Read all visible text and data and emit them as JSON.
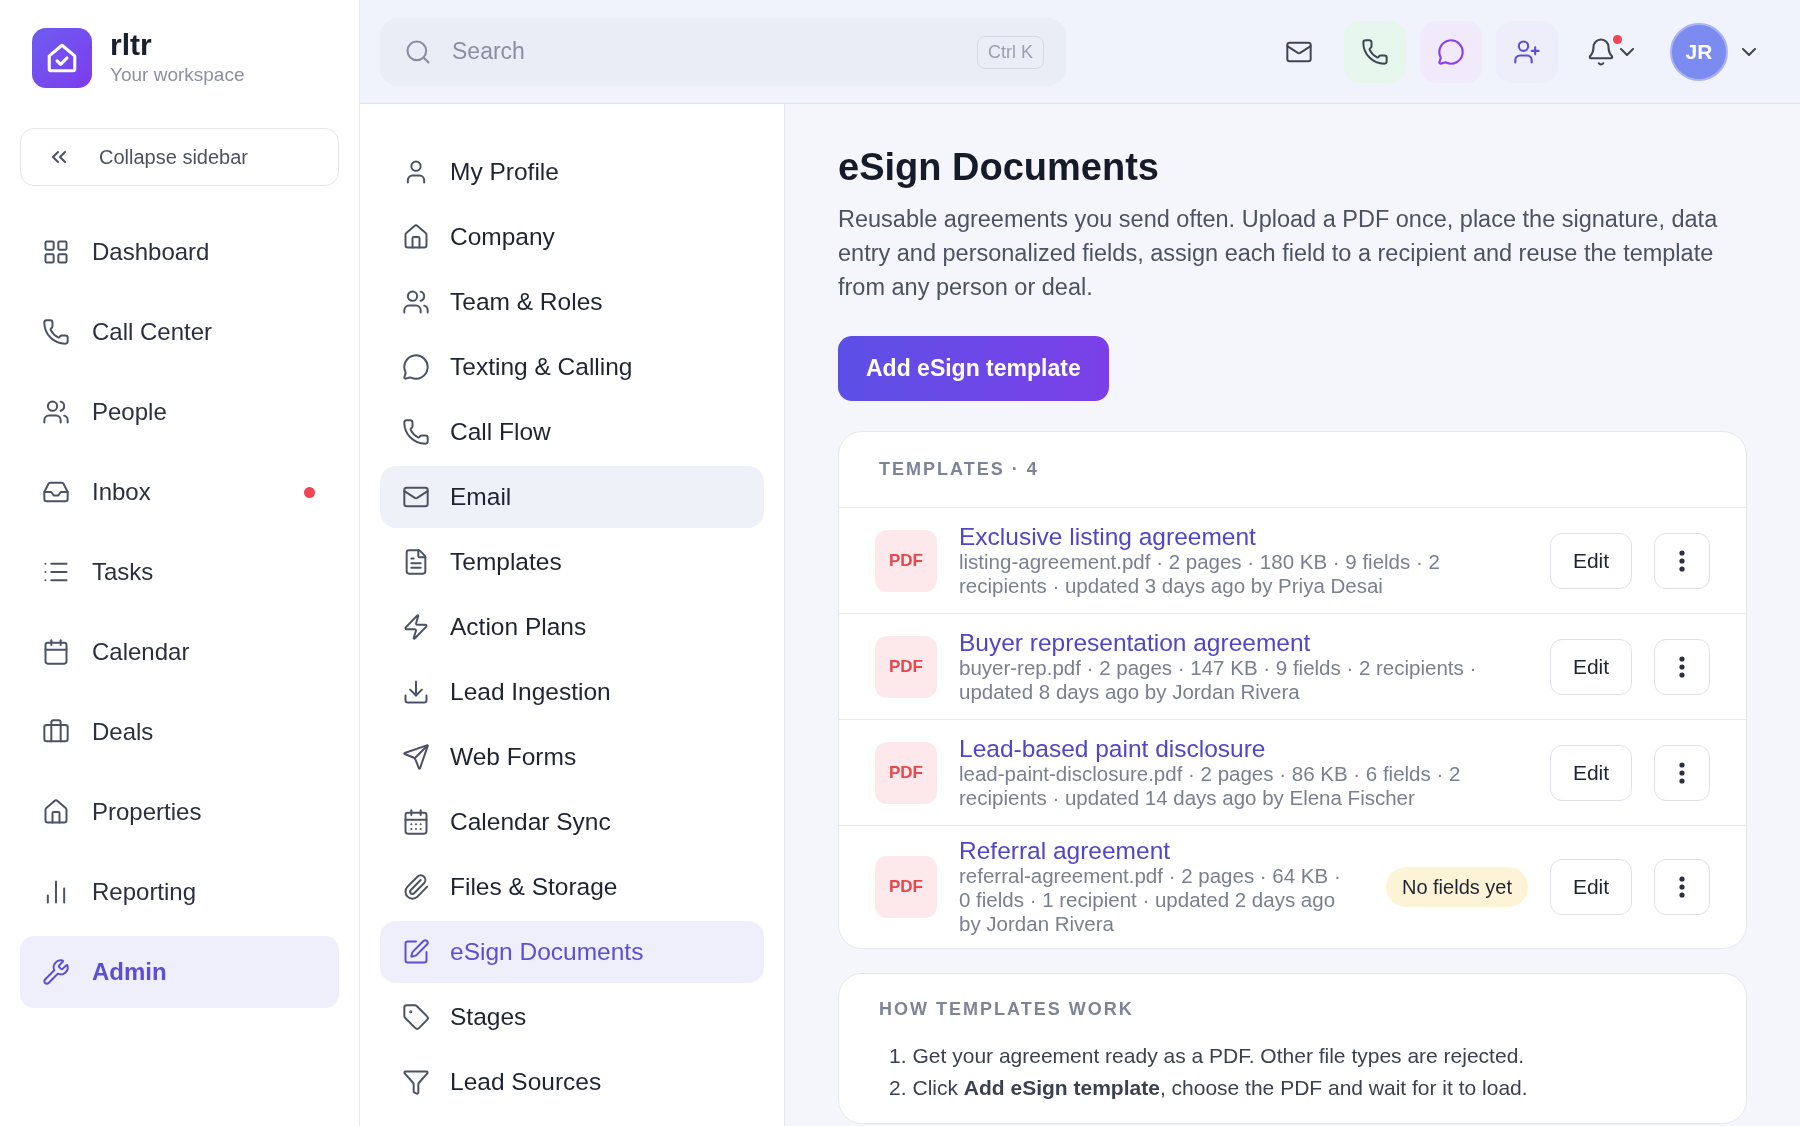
{
  "brand": {
    "name": "rltr",
    "subtitle": "Your workspace"
  },
  "collapse": {
    "label": "Collapse sidebar"
  },
  "sidebar": {
    "items": [
      {
        "label": "Dashboard",
        "selected": false,
        "dot": false
      },
      {
        "label": "Call Center",
        "selected": false,
        "dot": false
      },
      {
        "label": "People",
        "selected": false,
        "dot": false
      },
      {
        "label": "Inbox",
        "selected": false,
        "dot": true
      },
      {
        "label": "Tasks",
        "selected": false,
        "dot": false
      },
      {
        "label": "Calendar",
        "selected": false,
        "dot": false
      },
      {
        "label": "Deals",
        "selected": false,
        "dot": false
      },
      {
        "label": "Properties",
        "selected": false,
        "dot": false
      },
      {
        "label": "Reporting",
        "selected": false,
        "dot": false
      },
      {
        "label": "Admin",
        "selected": true,
        "dot": false
      }
    ]
  },
  "search": {
    "placeholder": "Search",
    "shortcut": "Ctrl K"
  },
  "topbar": {
    "notifications_unread": true,
    "avatar": "JR"
  },
  "settings_nav": {
    "items": [
      {
        "label": "My Profile",
        "selected": false,
        "hovered": false
      },
      {
        "label": "Company",
        "selected": false,
        "hovered": false
      },
      {
        "label": "Team & Roles",
        "selected": false,
        "hovered": false
      },
      {
        "label": "Texting & Calling",
        "selected": false,
        "hovered": false
      },
      {
        "label": "Call Flow",
        "selected": false,
        "hovered": false
      },
      {
        "label": "Email",
        "selected": false,
        "hovered": true
      },
      {
        "label": "Templates",
        "selected": false,
        "hovered": false
      },
      {
        "label": "Action Plans",
        "selected": false,
        "hovered": false
      },
      {
        "label": "Lead Ingestion",
        "selected": false,
        "hovered": false
      },
      {
        "label": "Web Forms",
        "selected": false,
        "hovered": false
      },
      {
        "label": "Calendar Sync",
        "selected": false,
        "hovered": false
      },
      {
        "label": "Files & Storage",
        "selected": false,
        "hovered": false
      },
      {
        "label": "eSign Documents",
        "selected": true,
        "hovered": false
      },
      {
        "label": "Stages",
        "selected": false,
        "hovered": false
      },
      {
        "label": "Lead Sources",
        "selected": false,
        "hovered": false
      }
    ]
  },
  "page": {
    "title": "eSign Documents",
    "description": "Reusable agreements you send often. Upload a PDF once, place the signature, data entry and personalized fields, assign each field to a recipient and reuse the template from any person or deal.",
    "primary_button": "Add eSign template"
  },
  "templates": {
    "heading": "TEMPLATES · 4",
    "rows": [
      {
        "file_type": "PDF",
        "title": "Exclusive listing agreement",
        "meta": "listing-agreement.pdf · 2 pages · 180 KB · 9 fields · 2 recipients · updated 3 days ago by Priya Desai",
        "edit": "Edit"
      },
      {
        "file_type": "PDF",
        "title": "Buyer representation agreement",
        "meta": "buyer-rep.pdf · 2 pages · 147 KB · 9 fields · 2 recipients · updated 8 days ago by Jordan Rivera",
        "edit": "Edit"
      },
      {
        "file_type": "PDF",
        "title": "Lead-based paint disclosure",
        "meta": "lead-paint-disclosure.pdf · 2 pages · 86 KB · 6 fields · 2 recipients · updated 14 days ago by Elena Fischer",
        "edit": "Edit"
      },
      {
        "file_type": "PDF",
        "title": "Referral agreement",
        "meta": "referral-agreement.pdf · 2 pages · 64 KB · 0 fields · 1 recipient · updated 2 days ago by Jordan Rivera",
        "badge": "No fields yet",
        "edit": "Edit"
      }
    ]
  },
  "how_it_works": {
    "heading": "HOW TEMPLATES WORK",
    "steps": [
      {
        "number": "1.",
        "text": "Get your agreement ready as a PDF. Other file types are rejected."
      },
      {
        "number": "2.",
        "text": "Click **Add eSign template**, choose the PDF and wait for it to load."
      }
    ]
  }
}
